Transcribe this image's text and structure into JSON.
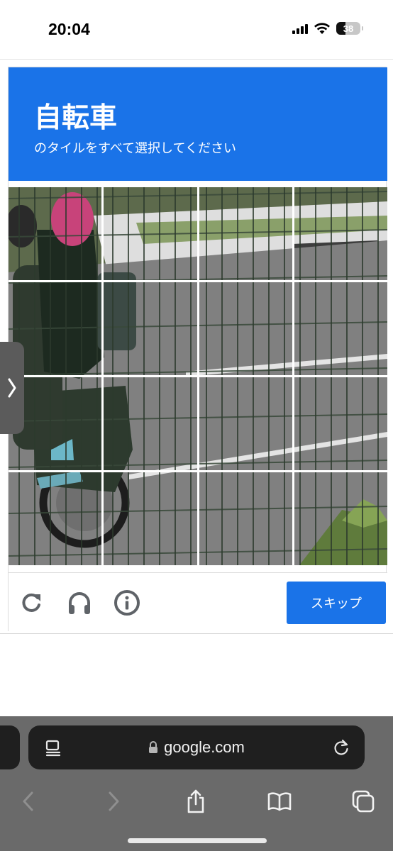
{
  "status_bar": {
    "time": "20:04",
    "battery": "38",
    "battery_level": 0.38,
    "icons": [
      "signal-icon",
      "wifi-icon",
      "battery-icon"
    ]
  },
  "captcha": {
    "title": "自転車",
    "subtitle": "のタイルをすべて選択してください",
    "grid": {
      "rows": 4,
      "columns": 4
    },
    "footer": {
      "icons": [
        "reload-icon",
        "headphones-icon",
        "info-icon"
      ],
      "skip_label": "スキップ"
    },
    "colors": {
      "accent": "#1a73e8"
    }
  },
  "browser": {
    "url": "google.com",
    "icons": [
      "page-menu-icon",
      "lock-icon",
      "reload-icon",
      "back-icon",
      "forward-icon",
      "share-icon",
      "bookmarks-icon",
      "tabs-icon"
    ]
  }
}
